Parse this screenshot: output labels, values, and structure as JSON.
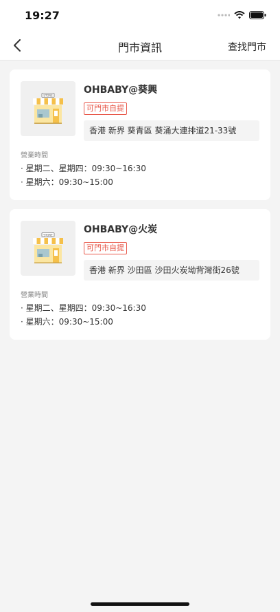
{
  "status": {
    "time": "19:27"
  },
  "nav": {
    "title": "門市資訊",
    "right_action": "查找門市"
  },
  "store_image_text": "STORE",
  "stores": [
    {
      "name": "OHBABY@葵興",
      "badge": "可門市自提",
      "address": "香港 新界 葵青區 葵涌大連排道21-33號",
      "hours_label": "營業時間",
      "hours": [
        "· 星期二、星期四：09:30~16:30",
        "· 星期六：09:30~15:00"
      ]
    },
    {
      "name": "OHBABY@火炭",
      "badge": "可門市自提",
      "address": "香港 新界 沙田區 沙田火炭坳背灣街26號",
      "hours_label": "營業時間",
      "hours": [
        "· 星期二、星期四：09:30~16:30",
        "· 星期六：09:30~15:00"
      ]
    }
  ],
  "colors": {
    "accent": "#e8584a",
    "background": "#f4f4f4"
  },
  "icons": [
    "back-chevron-icon",
    "signal-icon",
    "wifi-icon",
    "battery-icon",
    "store-icon"
  ]
}
